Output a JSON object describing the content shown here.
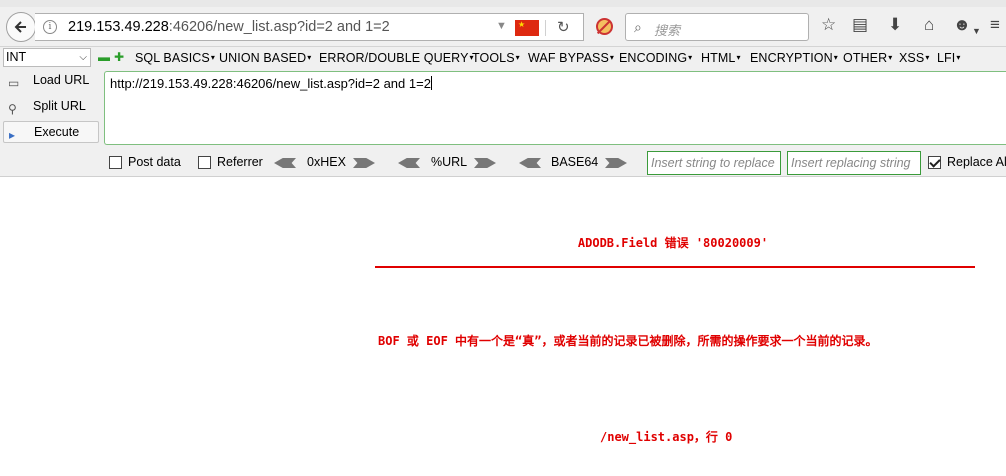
{
  "browser": {
    "url_host": "219.153.49.228",
    "url_rest": ":46206/new_list.asp?id=2 and 1=2",
    "search_placeholder": "搜索"
  },
  "hackbar": {
    "type_select": "INT",
    "menus": [
      "SQL BASICS",
      "UNION BASED",
      "ERROR/DOUBLE QUERY",
      "TOOLS",
      "WAF BYPASS",
      "ENCODING",
      "HTML",
      "ENCRYPTION",
      "OTHER",
      "XSS",
      "LFI"
    ],
    "load_url": "Load URL",
    "split_url": "Split URL",
    "execute": "Execute",
    "url_value": "http://219.153.49.228:46206/new_list.asp?id=2 and 1=2",
    "post_data": "Post data",
    "referrer": "Referrer",
    "hex": "0xHEX",
    "url_enc": "%URL",
    "base64": "BASE64",
    "insert_placeholder": "Insert string to replace",
    "replacing_placeholder": "Insert replacing string",
    "replace_all": "Replace All"
  },
  "error_page": {
    "title": "ADODB.Field 错误 '80020009'",
    "message": "BOF 或 EOF 中有一个是“真”，或者当前的记录已被删除，所需的操作要求一个当前的记录。",
    "location": "/new_list.asp，行 0",
    "color": "#e00000"
  }
}
